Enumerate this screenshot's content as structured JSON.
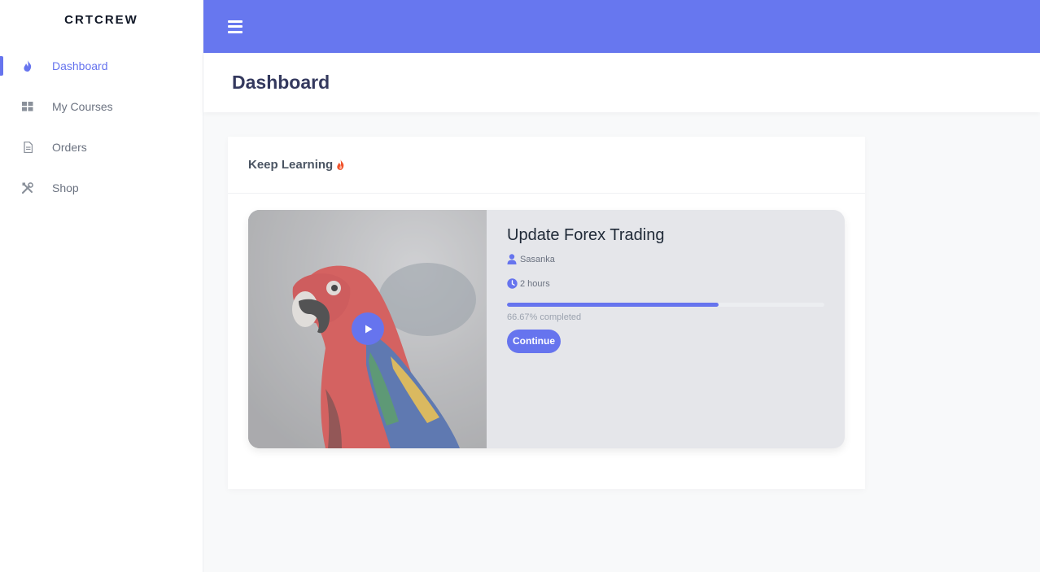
{
  "brand": "CRTCREW",
  "sidebar": {
    "items": [
      {
        "label": "Dashboard",
        "icon": "fire-icon",
        "active": true
      },
      {
        "label": "My Courses",
        "icon": "grid-icon"
      },
      {
        "label": "Orders",
        "icon": "document-icon"
      },
      {
        "label": "Shop",
        "icon": "tools-icon"
      }
    ]
  },
  "topbar": {
    "menu_icon": "hamburger-menu-icon"
  },
  "page": {
    "title": "Dashboard"
  },
  "card": {
    "header": "Keep Learning",
    "course": {
      "title": "Update Forex Trading",
      "author": "Sasanka",
      "duration": "2 hours",
      "progress": 66.67,
      "progress_label": "66.67% completed",
      "continue_label": "Continue"
    }
  },
  "colors": {
    "accent": "#6777ef",
    "fire": "#f0542d"
  }
}
